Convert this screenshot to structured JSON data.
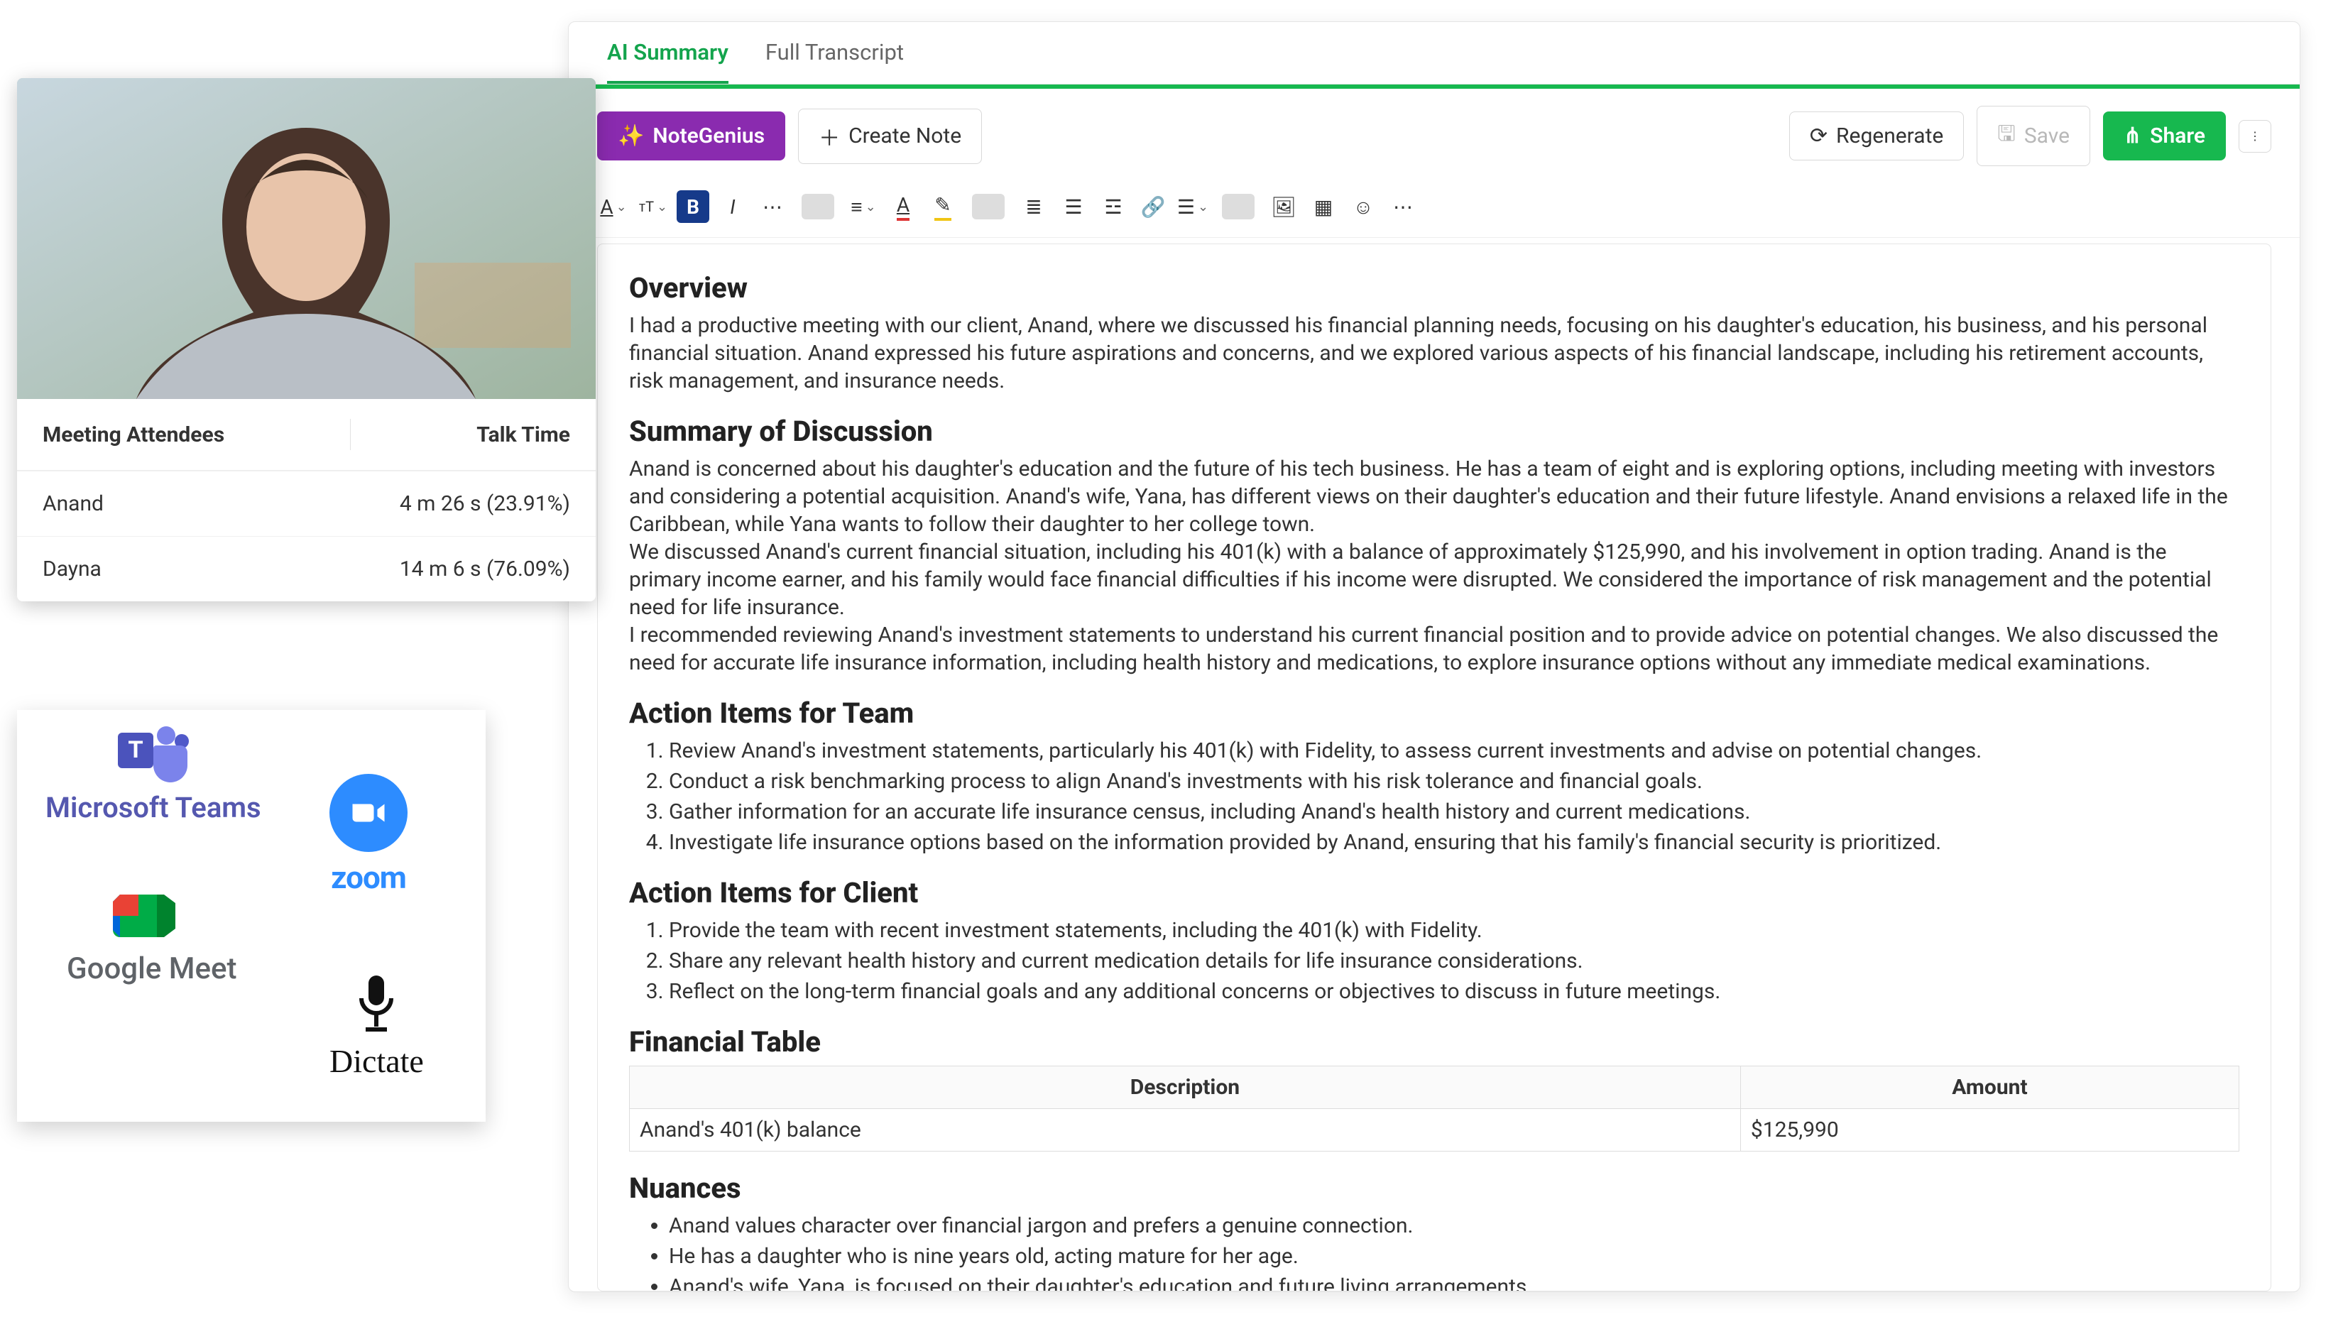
{
  "attendees": {
    "header_name": "Meeting Attendees",
    "header_time": "Talk Time",
    "rows": [
      {
        "name": "Anand",
        "time": "4 m 26 s (23.91%)"
      },
      {
        "name": "Dayna",
        "time": "14 m 6 s (76.09%)"
      }
    ]
  },
  "integrations": {
    "teams": "Microsoft Teams",
    "zoom": "zoom",
    "gmeet": "Google Meet",
    "dictate": "Dictate"
  },
  "tabs": {
    "ai_summary": "AI Summary",
    "full_transcript": "Full Transcript"
  },
  "actions": {
    "notegenius": "NoteGenius",
    "create_note": "Create Note",
    "regenerate": "Regenerate",
    "save": "Save",
    "share": "Share"
  },
  "doc": {
    "overview_h": "Overview",
    "overview_p": "I had a productive meeting with our client, Anand, where we discussed his financial planning needs, focusing on his daughter's education, his business, and his personal financial situation. Anand expressed his future aspirations and concerns, and we explored various aspects of his financial landscape, including his retirement accounts, risk management, and insurance needs.",
    "summary_h": "Summary of Discussion",
    "summary_p1": "Anand is concerned about his daughter's education and the future of his tech business. He has a team of eight and is exploring options, including meeting with investors and considering a potential acquisition. Anand's wife, Yana, has different views on their daughter's education and their future lifestyle. Anand envisions a relaxed life in the Caribbean, while Yana wants to follow their daughter to her college town.",
    "summary_p2": "We discussed Anand's current financial situation, including his 401(k) with a balance of approximately $125,990, and his involvement in option trading. Anand is the primary income earner, and his family would face financial difficulties if his income were disrupted. We considered the importance of risk management and the potential need for life insurance.",
    "summary_p3": "I recommended reviewing Anand's investment statements to understand his current financial position and to provide advice on potential changes. We also discussed the need for accurate life insurance information, including health history and medications, to explore insurance options without any immediate medical examinations.",
    "team_h": "Action Items for Team",
    "team_items": [
      "Review Anand's investment statements, particularly his 401(k) with Fidelity, to assess current investments and advise on potential changes.",
      "Conduct a risk benchmarking process to align Anand's investments with his risk tolerance and financial goals.",
      "Gather information for an accurate life insurance census, including Anand's health history and current medications.",
      "Investigate life insurance options based on the information provided by Anand, ensuring that his family's financial security is prioritized."
    ],
    "client_h": "Action Items for Client",
    "client_items": [
      "Provide the team with recent investment statements, including the 401(k) with Fidelity.",
      "Share any relevant health history and current medication details for life insurance considerations.",
      "Reflect on the long-term financial goals and any additional concerns or objectives to discuss in future meetings."
    ],
    "fin_h": "Financial Table",
    "fin_th1": "Description",
    "fin_th2": "Amount",
    "fin_td1": "Anand's 401(k) balance",
    "fin_td2": "$125,990",
    "nuances_h": "Nuances",
    "nuances_items": [
      "Anand values character over financial jargon and prefers a genuine connection.",
      "He has a daughter who is nine years old, acting mature for her age.",
      "Anand's wife, Yana, is focused on their daughter's education and future living arrangements."
    ]
  }
}
